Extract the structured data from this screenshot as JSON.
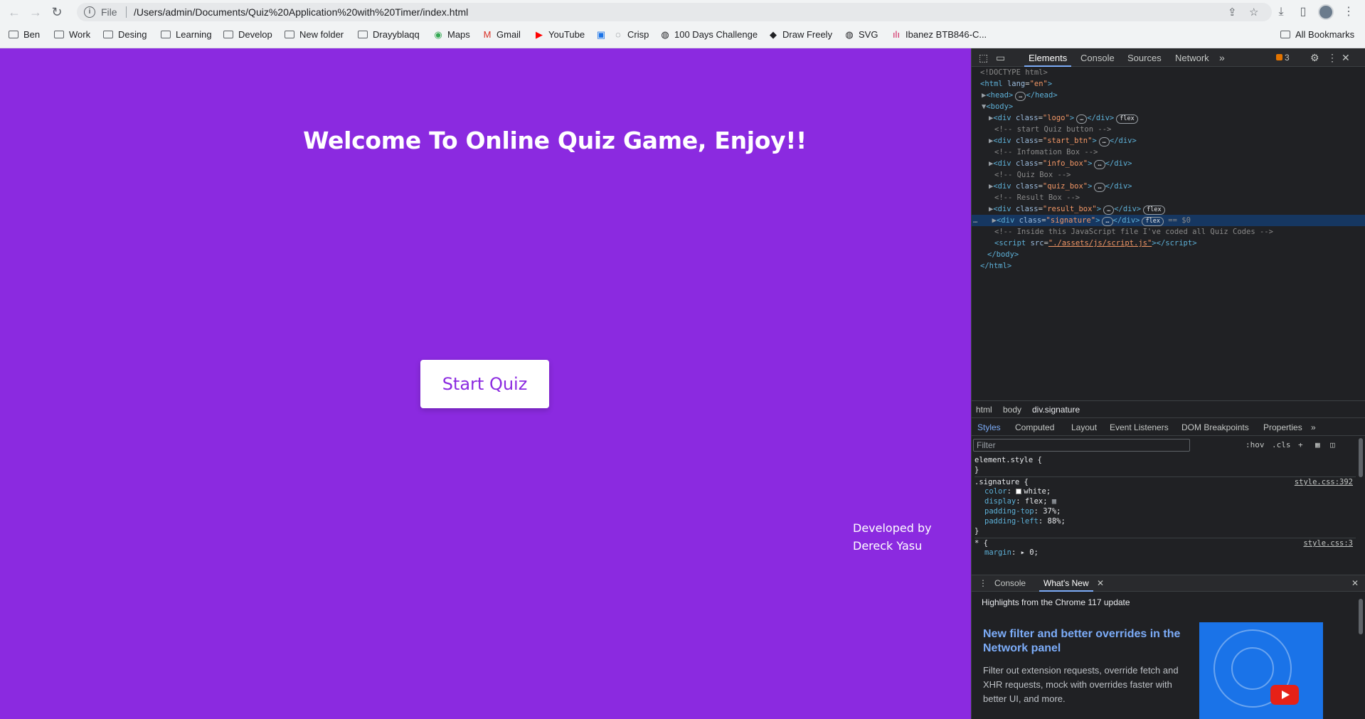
{
  "browser": {
    "scheme": "File",
    "url": "/Users/admin/Documents/Quiz%20Application%20with%20Timer/index.html",
    "bookmarks": [
      {
        "label": "Ben",
        "icon": "folder-icon"
      },
      {
        "label": "Work",
        "icon": "folder-icon"
      },
      {
        "label": "Desing",
        "icon": "folder-icon"
      },
      {
        "label": "Learning",
        "icon": "folder-icon"
      },
      {
        "label": "Develop",
        "icon": "folder-icon"
      },
      {
        "label": "New folder",
        "icon": "folder-icon"
      },
      {
        "label": "Drayyblaqq",
        "icon": "folder-icon"
      },
      {
        "label": "Maps",
        "icon": "maps-icon"
      },
      {
        "label": "Gmail",
        "icon": "gmail-icon"
      },
      {
        "label": "YouTube",
        "icon": "youtube-icon"
      },
      {
        "label": "",
        "icon": "bookmark-app-icon"
      },
      {
        "label": "Crisp",
        "icon": "crisp-icon"
      },
      {
        "label": "100 Days Challenge",
        "icon": "globe-icon"
      },
      {
        "label": "Draw Freely",
        "icon": "draw-icon"
      },
      {
        "label": "SVG",
        "icon": "globe-icon"
      },
      {
        "label": "Ibanez BTB846-C...",
        "icon": "ibanez-icon"
      }
    ],
    "all_bookmarks": "All Bookmarks"
  },
  "page": {
    "title": "Welcome To Online Quiz Game, Enjoy!!",
    "start_button": "Start Quiz",
    "signature_line1": "Developed by",
    "signature_line2": "Dereck Yasu"
  },
  "devtools": {
    "tabs": [
      "Elements",
      "Console",
      "Sources",
      "Network"
    ],
    "issues_count": "3",
    "breadcrumbs": [
      "html",
      "body",
      "div.signature"
    ],
    "style_tabs": [
      "Styles",
      "Computed",
      "Layout",
      "Event Listeners",
      "DOM Breakpoints",
      "Properties"
    ],
    "filter_placeholder": "Filter",
    "hov": ":hov",
    "cls": ".cls",
    "css_rules": {
      "element_style": "element.style {",
      "close": "}",
      "signature_selector": ".signature {",
      "signature_source": "style.css:392",
      "color_prop": "color",
      "color_val": "white;",
      "display_prop": "display",
      "display_val": "flex;",
      "pt_prop": "padding-top",
      "pt_val": "37%;",
      "pl_prop": "padding-left",
      "pl_val": "88%;",
      "star_selector": "* {",
      "star_source": "style.css:3",
      "margin_prop": "margin",
      "margin_val": "0;"
    },
    "drawer_tabs": [
      "Console",
      "What's New"
    ],
    "whats_new": {
      "heading": "Highlights from the Chrome 117 update",
      "title": "New filter and better overrides in the Network panel",
      "desc": "Filter out extension requests, override fetch and XHR requests, mock with overrides faster with better UI, and more."
    }
  }
}
